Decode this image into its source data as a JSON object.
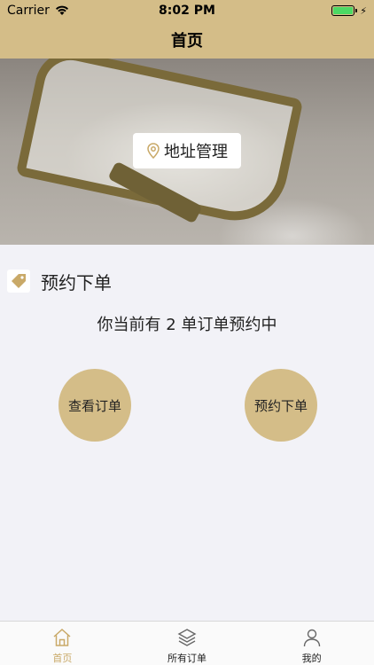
{
  "status_bar": {
    "carrier": "Carrier",
    "time": "8:02 PM"
  },
  "nav": {
    "title": "首页"
  },
  "banner": {
    "address_button_label": "地址管理"
  },
  "section": {
    "title": "预约下单",
    "icon": "tag-icon"
  },
  "reservation_info": {
    "text": "你当前有 2 单订单预约中",
    "count": 2
  },
  "actions": {
    "view_orders": "查看订单",
    "book_order": "预约下单"
  },
  "tab_bar": {
    "items": [
      {
        "label": "首页",
        "icon": "home-icon",
        "active": true
      },
      {
        "label": "所有订单",
        "icon": "layers-icon",
        "active": false
      },
      {
        "label": "我的",
        "icon": "user-icon",
        "active": false
      }
    ]
  },
  "colors": {
    "accent": "#d4bd88",
    "active_tab": "#c9a968",
    "battery": "#4cd964"
  }
}
